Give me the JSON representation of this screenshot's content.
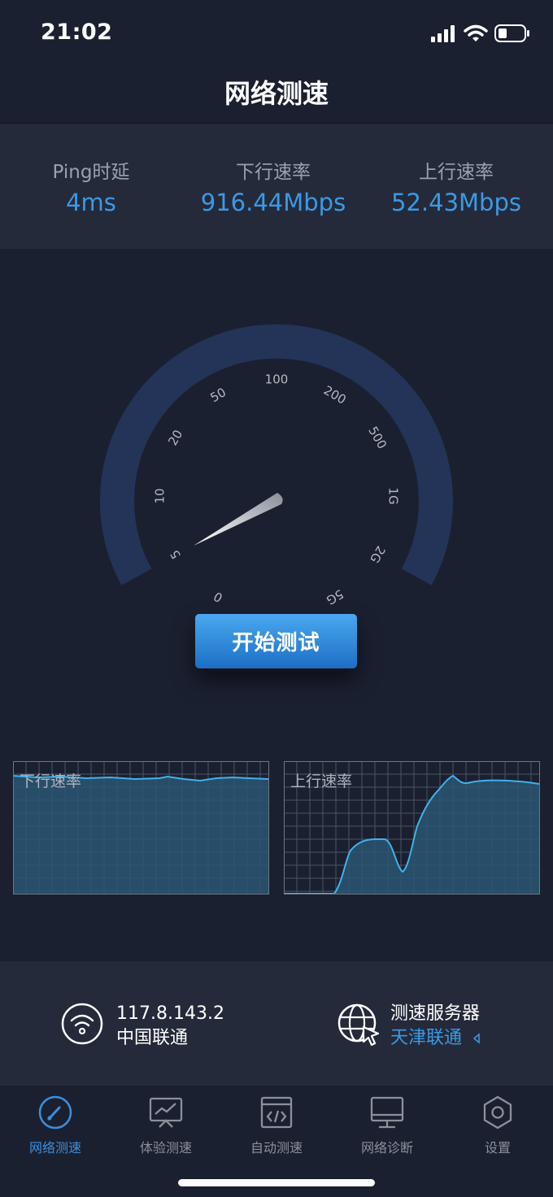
{
  "status_bar": {
    "time": "21:02"
  },
  "nav": {
    "title": "网络测速"
  },
  "metrics": [
    {
      "label": "Ping时延",
      "value": "4ms"
    },
    {
      "label": "下行速率",
      "value": "916.44Mbps"
    },
    {
      "label": "上行速率",
      "value": "52.43Mbps"
    }
  ],
  "gauge": {
    "ticks": [
      "0",
      "5",
      "10",
      "20",
      "50",
      "100",
      "200",
      "500",
      "1G",
      "2G",
      "5G"
    ]
  },
  "start_button": {
    "label": "开始测试"
  },
  "charts": {
    "download": {
      "label": "下行速率"
    },
    "upload": {
      "label": "上行速率"
    }
  },
  "network": {
    "ip": "117.8.143.2",
    "isp": "中国联通"
  },
  "server": {
    "title": "测速服务器",
    "name": "天津联通"
  },
  "tabs": [
    {
      "label": "网络测速",
      "icon": "speedometer-icon",
      "active": true
    },
    {
      "label": "体验测速",
      "icon": "monitor-chart-icon",
      "active": false
    },
    {
      "label": "自动测速",
      "icon": "code-window-icon",
      "active": false
    },
    {
      "label": "网络诊断",
      "icon": "desktop-icon",
      "active": false
    },
    {
      "label": "设置",
      "icon": "hexagon-settings-icon",
      "active": false
    }
  ],
  "colors": {
    "accent": "#3a9ae6",
    "background": "#1b2030",
    "panel": "#252a3a"
  }
}
